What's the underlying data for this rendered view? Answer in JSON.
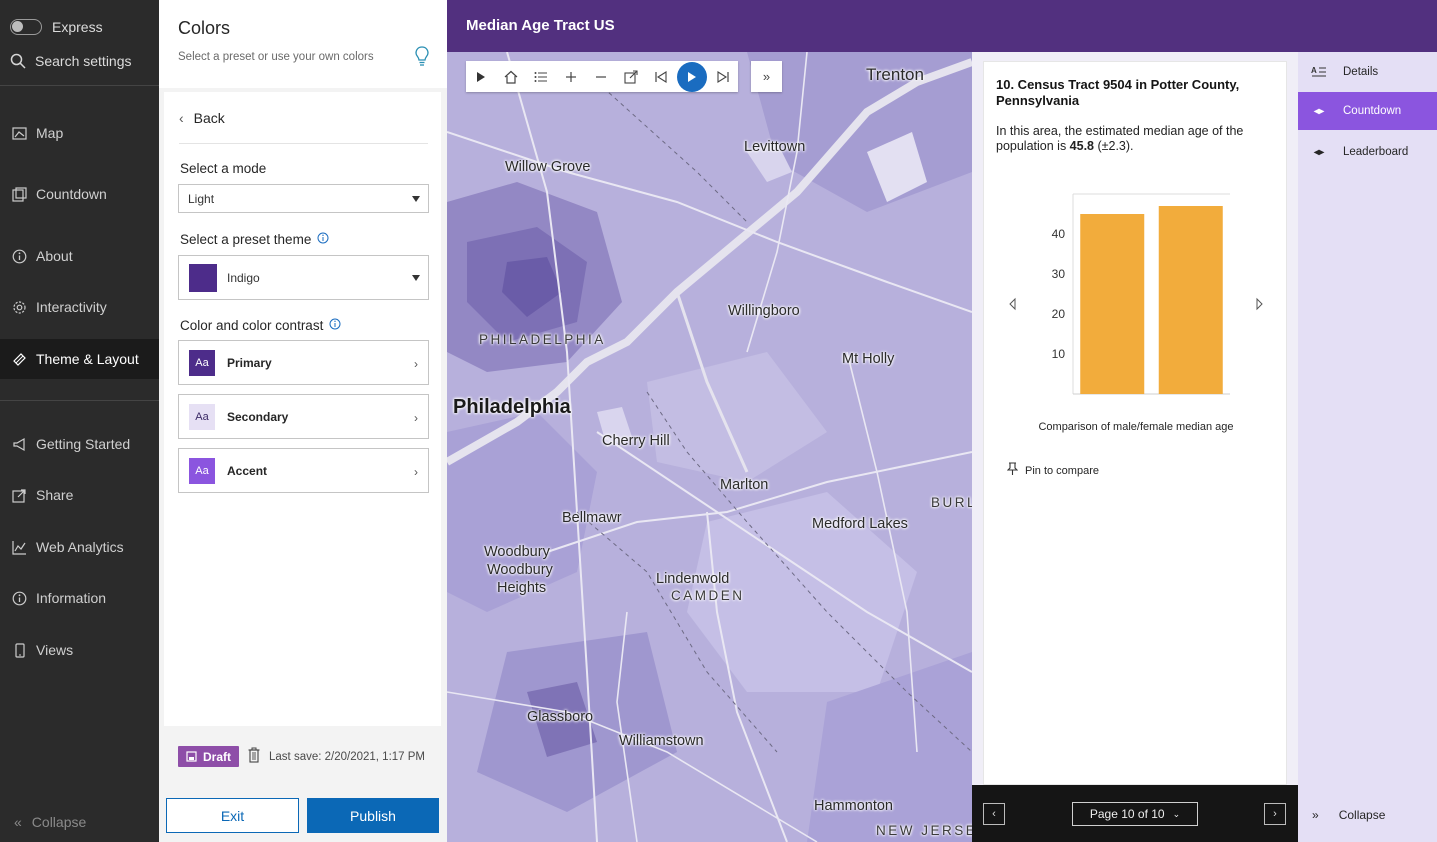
{
  "nav": {
    "express_label": "Express",
    "search_label": "Search settings",
    "items": [
      {
        "label": "Map",
        "icon": "map-icon"
      },
      {
        "label": "Countdown",
        "icon": "countdown-icon"
      },
      {
        "label": "About",
        "icon": "info-icon"
      },
      {
        "label": "Interactivity",
        "icon": "gear-icon"
      },
      {
        "label": "Theme & Layout",
        "icon": "palette-icon"
      },
      {
        "label": "Getting Started",
        "icon": "megaphone-icon"
      },
      {
        "label": "Share",
        "icon": "share-icon"
      },
      {
        "label": "Web Analytics",
        "icon": "chart-icon"
      },
      {
        "label": "Information",
        "icon": "info-icon"
      },
      {
        "label": "Views",
        "icon": "phone-icon"
      }
    ],
    "active_item": "Theme & Layout",
    "collapse_label": "Collapse"
  },
  "panel": {
    "title": "Colors",
    "subtitle": "Select a preset or use your own colors",
    "back_label": "Back",
    "mode_label": "Select a mode",
    "mode_value": "Light",
    "theme_label": "Select a preset theme",
    "theme_value": "Indigo",
    "theme_swatch": "#4d2c8a",
    "contrast_label": "Color and color contrast",
    "colors": [
      {
        "badge": "Aa",
        "label": "Primary",
        "bg": "#4d2c8a",
        "fg": "#ffffff"
      },
      {
        "badge": "Aa",
        "label": "Secondary",
        "bg": "#e6e0f4",
        "fg": "#3b2a66"
      },
      {
        "badge": "Aa",
        "label": "Accent",
        "bg": "#8b55df",
        "fg": "#ffffff"
      }
    ],
    "draft_label": "Draft",
    "last_save": "Last save: 2/20/2021, 1:17 PM",
    "exit_label": "Exit",
    "publish_label": "Publish"
  },
  "header": {
    "title": "Median Age Tract US"
  },
  "map": {
    "places": [
      {
        "name": "Trenton",
        "style": ""
      },
      {
        "name": "Willow Grove",
        "style": ""
      },
      {
        "name": "Levittown",
        "style": ""
      },
      {
        "name": "Willingboro",
        "style": ""
      },
      {
        "name": "PHILADELPHIA",
        "style": "caps"
      },
      {
        "name": "Mt Holly",
        "style": ""
      },
      {
        "name": "Philadelphia",
        "style": "big"
      },
      {
        "name": "Cherry Hill",
        "style": ""
      },
      {
        "name": "Marlton",
        "style": ""
      },
      {
        "name": "BURL",
        "style": "caps"
      },
      {
        "name": "Bellmawr",
        "style": ""
      },
      {
        "name": "Medford Lakes",
        "style": ""
      },
      {
        "name": "Woodbury",
        "style": ""
      },
      {
        "name": "Woodbury",
        "style": ""
      },
      {
        "name": "Heights",
        "style": ""
      },
      {
        "name": "Lindenwold",
        "style": ""
      },
      {
        "name": "CAMDEN",
        "style": "caps"
      },
      {
        "name": "Glassboro",
        "style": ""
      },
      {
        "name": "Williamstown",
        "style": ""
      },
      {
        "name": "Hammonton",
        "style": ""
      },
      {
        "name": "NEW JERSE",
        "style": "caps"
      }
    ]
  },
  "countdown": {
    "title": "10. Census Tract 9504 in Potter County, Pennsylvania",
    "text_before": "In this area, the estimated median age of the population is ",
    "text_value": "45.8",
    "text_after": " (±2.3).",
    "caption": "Comparison of male/female median age",
    "pin_label": "Pin to compare",
    "page_label": "Page 10 of 10"
  },
  "chart_data": {
    "type": "bar",
    "categories": [
      "",
      ""
    ],
    "values": [
      45,
      47
    ],
    "yticks": [
      10,
      20,
      30,
      40
    ],
    "ylim": [
      0,
      50
    ],
    "bar_color": "#f2ac3c",
    "title": "Comparison of male/female median age"
  },
  "tabs": {
    "items": [
      {
        "label": "Details",
        "icon": "details-icon"
      },
      {
        "label": "Countdown",
        "icon": "arrows-icon"
      },
      {
        "label": "Leaderboard",
        "icon": "arrows-icon"
      }
    ],
    "active": "Countdown",
    "collapse_label": "Collapse"
  },
  "colors": {
    "header_bg": "#52307f",
    "accent": "#8b55df",
    "button_blue": "#0b68b6",
    "draft": "#8e4ea8",
    "sidebar_bg": "#2b2b2b"
  }
}
